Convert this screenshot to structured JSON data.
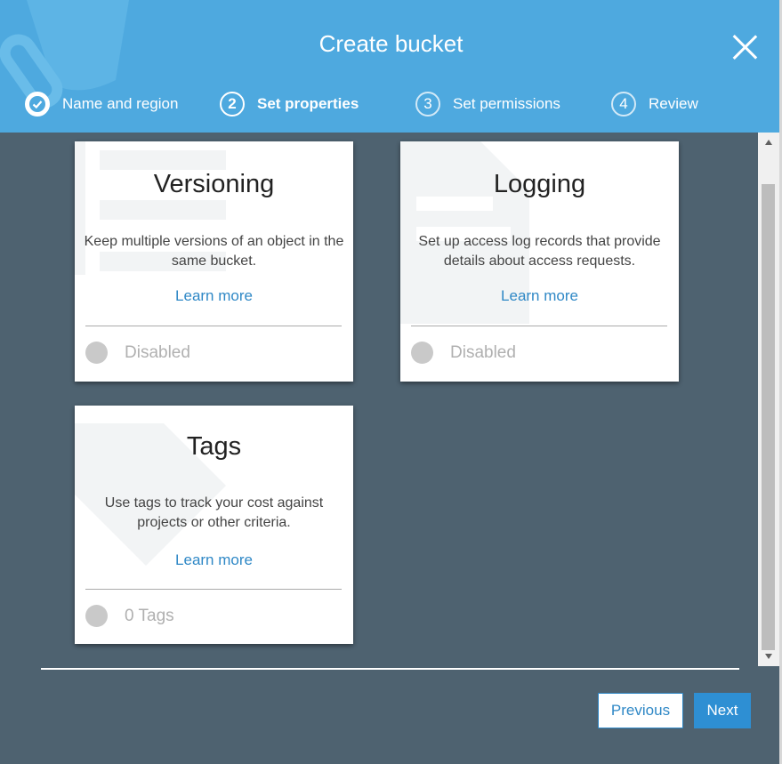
{
  "dialog": {
    "title": "Create bucket"
  },
  "steps": [
    {
      "num": "",
      "label": "Name and region",
      "state": "done"
    },
    {
      "num": "2",
      "label": "Set properties",
      "state": "active"
    },
    {
      "num": "3",
      "label": "Set permissions",
      "state": "pending"
    },
    {
      "num": "4",
      "label": "Review",
      "state": "pending"
    }
  ],
  "cards": {
    "versioning": {
      "title": "Versioning",
      "desc": "Keep multiple versions of an object in the same bucket.",
      "learn": "Learn more",
      "status": "Disabled"
    },
    "logging": {
      "title": "Logging",
      "desc": "Set up access log records that provide details about access requests.",
      "learn": "Learn more",
      "status": "Disabled"
    },
    "tags": {
      "title": "Tags",
      "desc": "Use tags to track your cost against projects or other criteria.",
      "learn": "Learn more",
      "status": "0 Tags"
    }
  },
  "footer": {
    "previous": "Previous",
    "next": "Next"
  },
  "colors": {
    "header": "#4ea9df",
    "backdrop": "#4e6270",
    "link": "#2f88c6",
    "primary": "#2e8fd3"
  }
}
